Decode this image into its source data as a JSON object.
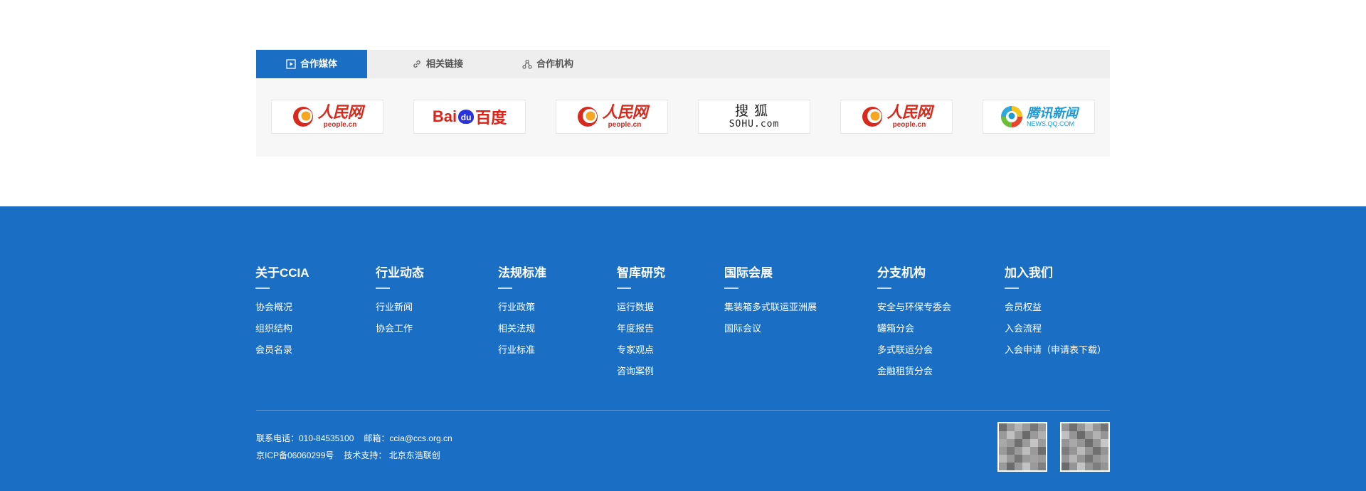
{
  "partners": {
    "tabs": [
      {
        "label": "合作媒体",
        "icon": "play-square-icon",
        "active": true
      },
      {
        "label": "相关链接",
        "icon": "link-icon",
        "active": false
      },
      {
        "label": "合作机构",
        "icon": "org-icon",
        "active": false
      }
    ],
    "logos": [
      {
        "name": "people",
        "cn": "人民网",
        "en": "people.cn"
      },
      {
        "name": "baidu",
        "part1": "Bai",
        "paw": "du",
        "part2": "百度"
      },
      {
        "name": "people",
        "cn": "人民网",
        "en": "people.cn"
      },
      {
        "name": "sohu",
        "cn": "搜狐",
        "en": "SOHU.com"
      },
      {
        "name": "people",
        "cn": "人民网",
        "en": "people.cn"
      },
      {
        "name": "qq",
        "cn": "腾讯新闻",
        "en": "NEWS.QQ.COM"
      }
    ]
  },
  "footer": {
    "columns": [
      {
        "title": "关于CCIA",
        "links": [
          "协会概况",
          "组织结构",
          "会员名录"
        ]
      },
      {
        "title": "行业动态",
        "links": [
          "行业新闻",
          "协会工作"
        ]
      },
      {
        "title": "法规标准",
        "links": [
          "行业政策",
          "相关法规",
          "行业标准"
        ]
      },
      {
        "title": "智库研究",
        "links": [
          "运行数据",
          "年度报告",
          "专家观点",
          "咨询案例"
        ]
      },
      {
        "title": "国际会展",
        "links": [
          "集装箱多式联运亚洲展",
          "国际会议"
        ]
      },
      {
        "title": "分支机构",
        "links": [
          "安全与环保专委会",
          "罐箱分会",
          "多式联运分会",
          "金融租赁分会"
        ]
      },
      {
        "title": "加入我们",
        "links": [
          "会员权益",
          "入会流程",
          "入会申请（申请表下载）"
        ]
      }
    ],
    "contact": {
      "phone": "联系电话：010-84535100",
      "email": "邮箱：ccia@ccs.org.cn",
      "icp": "京ICP备06060299号",
      "support": "技术支持： 北京东浩联创"
    }
  },
  "colors": {
    "brand_blue": "#1a6fc4",
    "tab_bg": "#eeeeee"
  }
}
